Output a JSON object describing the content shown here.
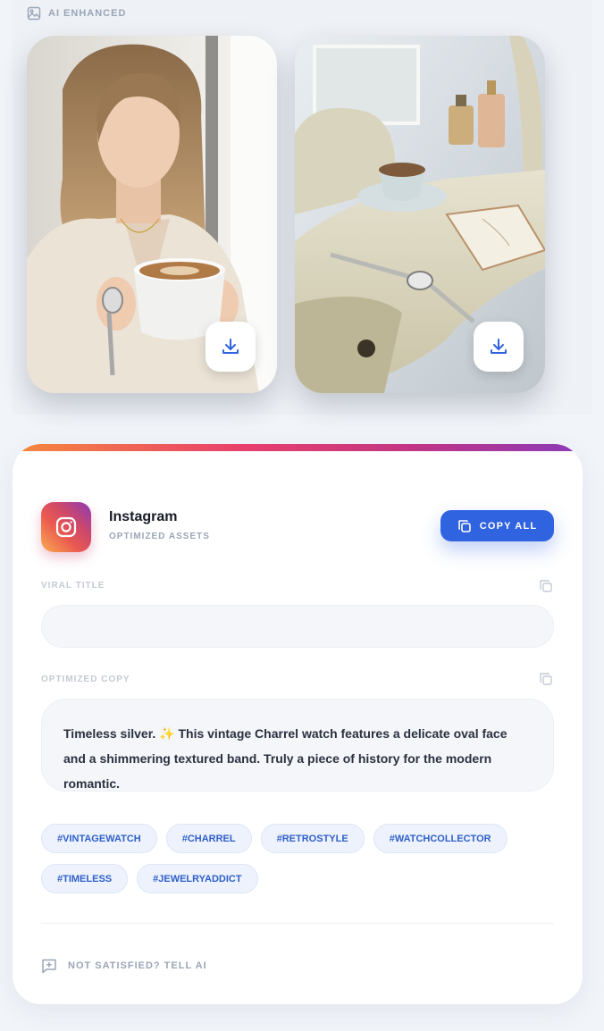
{
  "gallery": {
    "section_label": "AI ENHANCED",
    "section_icon": "image-icon",
    "images": [
      {
        "subject": "woman-holding-coffee-with-vintage-watch",
        "action_icon": "download-icon"
      },
      {
        "subject": "watch-on-vanity-table-with-tea-and-notebook",
        "action_icon": "download-icon"
      }
    ]
  },
  "platform_card": {
    "accent_colors": [
      "#f58a3c",
      "#e8406c",
      "#c13584",
      "#8a3ab9"
    ],
    "platform_name": "Instagram",
    "platform_subtitle": "OPTIMIZED ASSETS",
    "copy_all_label": "COPY ALL",
    "viral_title": {
      "label": "VIRAL TITLE",
      "value": ""
    },
    "optimized_copy": {
      "label": "OPTIMIZED COPY",
      "value": "Timeless silver. ✨ This vintage Charrel watch features a delicate oval face and a shimmering textured band. Truly a piece of history for the modern romantic."
    },
    "hashtags": [
      "#VINTAGEWATCH",
      "#CHARREL",
      "#RETROSTYLE",
      "#WATCHCOLLECTOR",
      "#TIMELESS",
      "#JEWELRYADDICT"
    ],
    "feedback_label": "NOT SATISFIED? TELL AI"
  },
  "colors": {
    "primary": "#2f63e0",
    "tag_text": "#2f5fc8",
    "muted": "#9aa5b6"
  }
}
